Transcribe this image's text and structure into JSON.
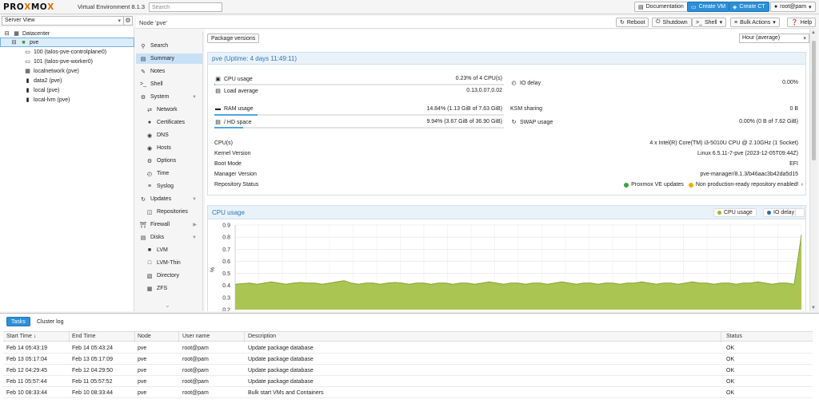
{
  "header": {
    "logo_prefix": "PRO",
    "logo_x": "X",
    "logo_mid": "MO",
    "logo_x2": "X",
    "version": "Virtual Environment 8.1.3",
    "search_placeholder": "Search",
    "documentation": "Documentation",
    "create_vm": "Create VM",
    "create_ct": "Create CT",
    "user": "root@pam"
  },
  "server_view": {
    "label": "Server View",
    "tree": [
      {
        "label": "Datacenter",
        "icon": "datacenter-icon"
      },
      {
        "label": "pve",
        "icon": "node-icon"
      },
      {
        "label": "100 (talos-pve-controlplane0)",
        "icon": "vm-icon"
      },
      {
        "label": "101 (talos-pve-worker0)",
        "icon": "vm-icon"
      },
      {
        "label": "localnetwork (pve)",
        "icon": "network-icon"
      },
      {
        "label": "data2 (pve)",
        "icon": "storage-icon"
      },
      {
        "label": "local (pve)",
        "icon": "storage-icon"
      },
      {
        "label": "local-lvm (pve)",
        "icon": "storage-icon"
      }
    ]
  },
  "nodebar": {
    "title": "Node 'pve'",
    "reboot": "Reboot",
    "shutdown": "Shutdown",
    "shell": "Shell",
    "bulk_actions": "Bulk Actions",
    "help": "Help"
  },
  "menu": [
    {
      "label": "Search",
      "icon": "search-icon",
      "level": 0
    },
    {
      "label": "Summary",
      "icon": "summary-icon",
      "level": 0
    },
    {
      "label": "Notes",
      "icon": "notes-icon",
      "level": 0
    },
    {
      "label": "Shell",
      "icon": "terminal-icon",
      "level": 0
    },
    {
      "label": "System",
      "icon": "gear-icon",
      "level": 0
    },
    {
      "label": "Network",
      "icon": "network-icon",
      "level": 1
    },
    {
      "label": "Certificates",
      "icon": "certificate-icon",
      "level": 1
    },
    {
      "label": "DNS",
      "icon": "globe-icon",
      "level": 1
    },
    {
      "label": "Hosts",
      "icon": "globe-icon",
      "level": 1
    },
    {
      "label": "Options",
      "icon": "gear-icon",
      "level": 1
    },
    {
      "label": "Time",
      "icon": "clock-icon",
      "level": 1
    },
    {
      "label": "Syslog",
      "icon": "list-icon",
      "level": 1
    },
    {
      "label": "Updates",
      "icon": "refresh-icon",
      "level": 0
    },
    {
      "label": "Repositories",
      "icon": "repository-icon",
      "level": 1
    },
    {
      "label": "Firewall",
      "icon": "shield-icon",
      "level": 0
    },
    {
      "label": "Disks",
      "icon": "disk-icon",
      "level": 0
    },
    {
      "label": "LVM",
      "icon": "square-icon",
      "level": 1
    },
    {
      "label": "LVM-Thin",
      "icon": "square-outline-icon",
      "level": 1
    },
    {
      "label": "Directory",
      "icon": "folder-icon",
      "level": 1
    },
    {
      "label": "ZFS",
      "icon": "grid-icon",
      "level": 1
    }
  ],
  "content": {
    "package_versions": "Package versions",
    "timeframe": "Hour (average)",
    "status_title": "pve (Uptime: 4 days 11:49:11)",
    "cpu_usage_label": "CPU usage",
    "cpu_usage_value": "0.23% of 4 CPU(s)",
    "cpu_usage_fraction": 0.0023,
    "io_delay_label": "IO delay",
    "io_delay_value": "0.00%",
    "load_average_label": "Load average",
    "load_average_value": "0.13,0.07,0.02",
    "ram_usage_label": "RAM usage",
    "ram_usage_value": "14.84% (1.13 GiB of 7.63 GiB)",
    "ram_usage_fraction": 0.1484,
    "ksm_sharing_label": "KSM sharing",
    "ksm_sharing_value": "0 B",
    "hd_space_label": "/ HD space",
    "hd_space_value": "9.94% (3.67 GiB of 36.90 GiB)",
    "hd_space_fraction": 0.0994,
    "swap_usage_label": "SWAP usage",
    "swap_usage_value": "0.00% (0 B of 7.62 GiB)",
    "cpus_label": "CPU(s)",
    "cpus_value": "4 x Intel(R) Core(TM) i3-5010U CPU @ 2.10GHz (1 Socket)",
    "kernel_label": "Kernel Version",
    "kernel_value": "Linux 6.5.11-7-pve (2023-12-05T09:44Z)",
    "boot_label": "Boot Mode",
    "boot_value": "EFI",
    "manager_label": "Manager Version",
    "manager_value": "pve-manager/8.1.3/b46aac3b42da5d15",
    "repo_label": "Repository Status",
    "repo_ok": "Proxmox VE updates",
    "repo_warn": "Non production-ready repository enabled!"
  },
  "chart_data": {
    "type": "area",
    "title": "CPU usage",
    "xlabel": "",
    "ylabel": "%",
    "ylim": [
      0.2,
      0.9
    ],
    "yticks": [
      0.9,
      0.8,
      0.7,
      0.6,
      0.5,
      0.4,
      0.3,
      0.2
    ],
    "grid": true,
    "legend": [
      "CPU usage",
      "IO delay"
    ],
    "legend_colors": [
      "#98b930",
      "#1f6fb5"
    ],
    "series": [
      {
        "name": "CPU usage",
        "color": "#a6c24a",
        "values": [
          0.41,
          0.415,
          0.42,
          0.41,
          0.42,
          0.43,
          0.42,
          0.41,
          0.42,
          0.425,
          0.42,
          0.42,
          0.41,
          0.42,
          0.43,
          0.44,
          0.42,
          0.41,
          0.42,
          0.42,
          0.41,
          0.42,
          0.425,
          0.42,
          0.41,
          0.42,
          0.42,
          0.41,
          0.42,
          0.42,
          0.41,
          0.42,
          0.42,
          0.41,
          0.42,
          0.43,
          0.42,
          0.41,
          0.42,
          0.42,
          0.41,
          0.42,
          0.42,
          0.41,
          0.42,
          0.43,
          0.42,
          0.41,
          0.42,
          0.42,
          0.41,
          0.42,
          0.42,
          0.41,
          0.42,
          0.42,
          0.43,
          0.42,
          0.41,
          0.42,
          0.42,
          0.41,
          0.42,
          0.43,
          0.42,
          0.42,
          0.41,
          0.42,
          0.42,
          0.41,
          0.42,
          0.42,
          0.43,
          0.42,
          0.41,
          0.42,
          0.42,
          0.41,
          0.82
        ]
      }
    ]
  },
  "tasks": {
    "tab_tasks": "Tasks",
    "tab_cluster_log": "Cluster log",
    "columns": [
      "Start Time",
      "End Time",
      "Node",
      "User name",
      "Description",
      "Status"
    ],
    "rows": [
      [
        "Feb 14 05:43:19",
        "Feb 14 05:43:24",
        "pve",
        "root@pam",
        "Update package database",
        "OK"
      ],
      [
        "Feb 13 05:17:04",
        "Feb 13 05:17:09",
        "pve",
        "root@pam",
        "Update package database",
        "OK"
      ],
      [
        "Feb 12 04:29:45",
        "Feb 12 04:29:50",
        "pve",
        "root@pam",
        "Update package database",
        "OK"
      ],
      [
        "Feb 11 05:57:44",
        "Feb 11 05:57:52",
        "pve",
        "root@pam",
        "Update package database",
        "OK"
      ],
      [
        "Feb 10 08:33:44",
        "Feb 10 08:33:44",
        "pve",
        "root@pam",
        "Bulk start VMs and Containers",
        "OK"
      ]
    ]
  }
}
